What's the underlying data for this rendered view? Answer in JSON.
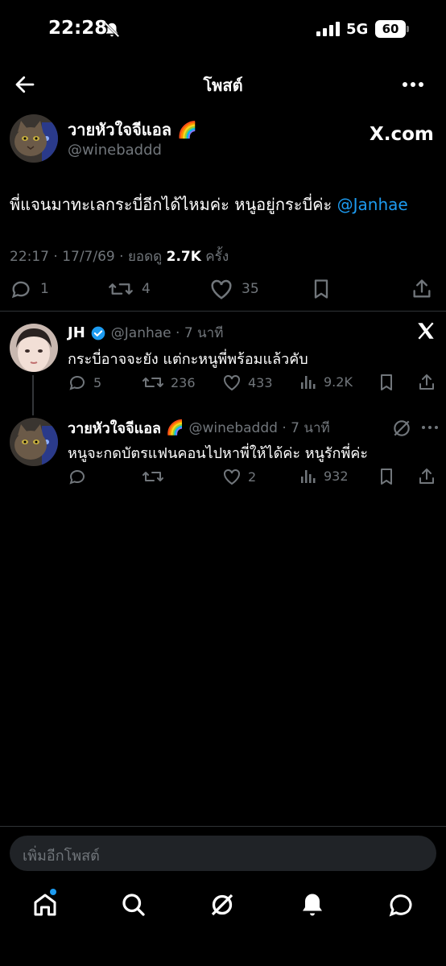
{
  "status_bar": {
    "time": "22:28",
    "network": "5G",
    "battery": "60"
  },
  "header": {
    "title": "โพสต์"
  },
  "post": {
    "author_name": "วายหัวใจจีแอล",
    "author_emoji": "🌈",
    "handle": "@winebaddd",
    "source_badge": "X.com",
    "text": "พี่แจนมาทะเลกระบี่อีกได้ไหมค่ะ หนูอยู่กระบี่ค่ะ ",
    "mention": "@Janhae",
    "meta_prefix": "22:17 · 17/7/69 · ยอดดู ",
    "views": "2.7K",
    "meta_suffix": " ครั้ง",
    "replies": "1",
    "reposts": "4",
    "likes": "35"
  },
  "replies": [
    {
      "name": "JH",
      "handle": "@Janhae · 7 นาที",
      "text": "กระบี่อาจจะยัง แต่กะหนูพี่พร้อมแล้วคับ",
      "replies": "5",
      "reposts": "236",
      "likes": "433",
      "views": "9.2K"
    },
    {
      "name": "วายหัวใจจีแอล",
      "emoji": "🌈",
      "handle": "@winebaddd · 7 นาที",
      "text": "หนูจะกดบัตรแฟนคอนไปหาพี่ให้ได้ค่ะ หนูรักพี่ค่ะ",
      "likes": "2",
      "views": "932"
    }
  ],
  "compose": {
    "placeholder": "เพิ่มอีกโพสต์"
  },
  "colors": {
    "accent": "#1d9bf0",
    "background": "#000000",
    "muted": "#71767b",
    "divider": "#2f3336"
  },
  "icons": [
    "back-arrow-icon",
    "more-icon",
    "reply-icon",
    "repost-icon",
    "like-icon",
    "bookmark-icon",
    "share-icon",
    "views-icon",
    "verified-icon",
    "x-logo-icon",
    "grok-icon",
    "home-icon",
    "search-icon",
    "bell-icon",
    "chat-icon"
  ]
}
